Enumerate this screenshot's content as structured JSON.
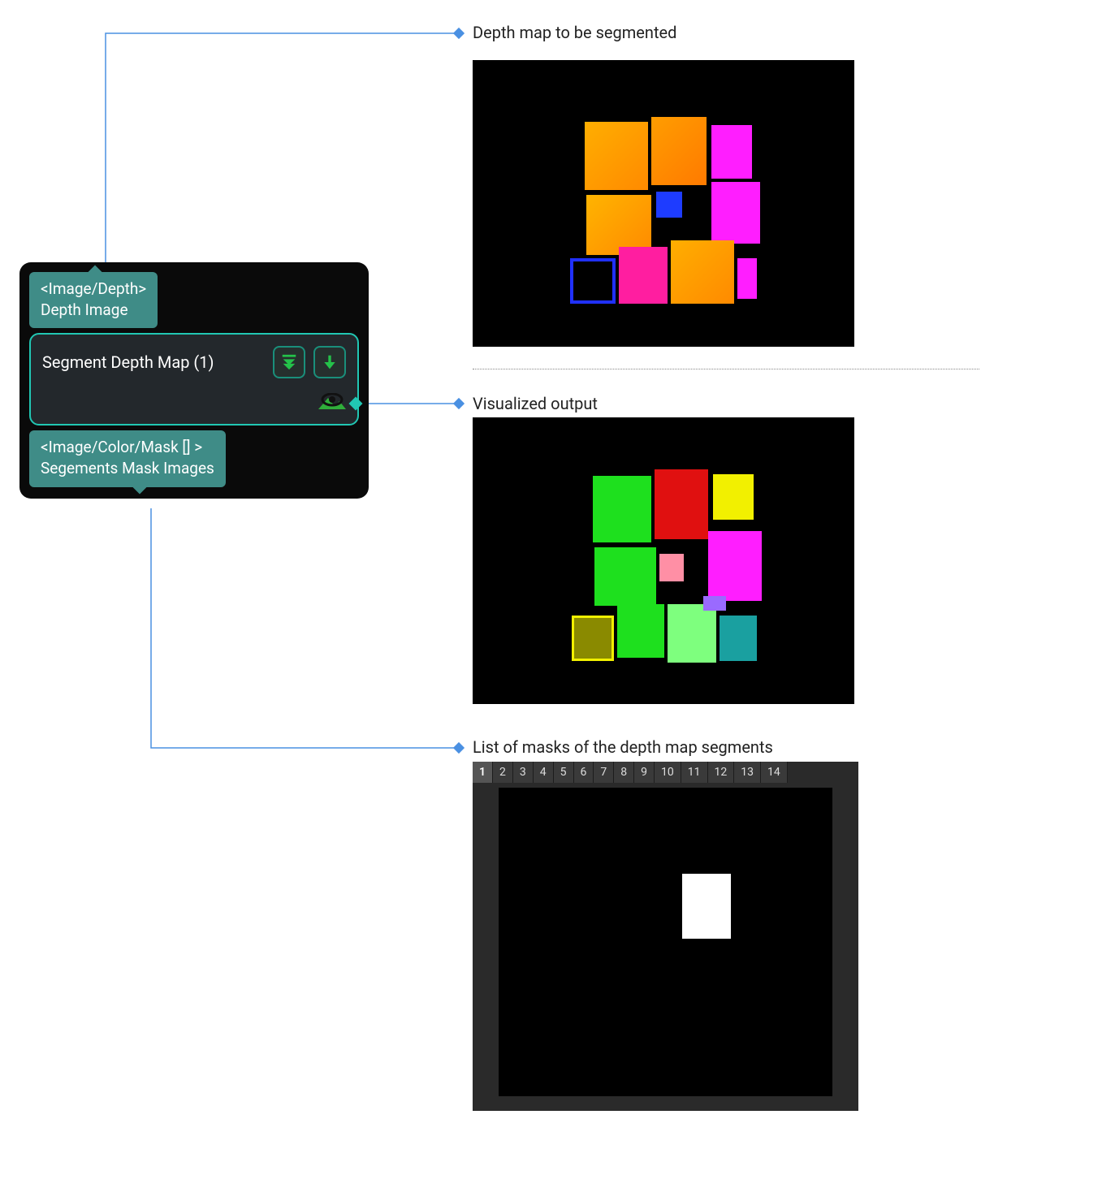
{
  "node": {
    "input_port": {
      "type_label": "<Image/Depth>",
      "name": "Depth Image"
    },
    "title": "Segment Depth Map (1)",
    "output_port": {
      "type_label": "<Image/Color/Mask [] >",
      "name": "Segements Mask Images"
    }
  },
  "callouts": {
    "depth_title": "Depth map to be segmented",
    "vis_title": "Visualized output",
    "masks_title": "List of masks of the depth map segments"
  },
  "mask_tabs": [
    "1",
    "2",
    "3",
    "4",
    "5",
    "6",
    "7",
    "8",
    "9",
    "10",
    "11",
    "12",
    "13",
    "14"
  ],
  "mask_tab_active": "1",
  "colors": {
    "connector": "#4a90e2",
    "node_accent": "#21c7b3",
    "port_bg": "#3f8c87"
  }
}
